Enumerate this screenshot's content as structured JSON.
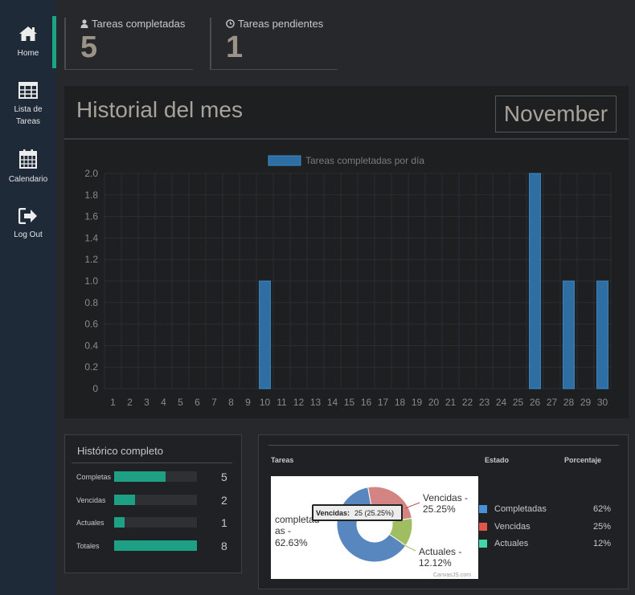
{
  "nav": {
    "items": [
      {
        "label": "Home",
        "icon": "home-icon"
      },
      {
        "label": "Lista de Tareas",
        "icon": "table-icon"
      },
      {
        "label": "Calendario",
        "icon": "calendar-icon"
      },
      {
        "label": "Log Out",
        "icon": "logout-icon"
      }
    ]
  },
  "stats": {
    "completed_label": "Tareas completadas",
    "completed_value": "5",
    "pending_label": "Tareas pendientes",
    "pending_value": "1"
  },
  "history": {
    "title": "Historial del mes",
    "month": "November"
  },
  "chart_data": {
    "type": "bar",
    "legend": "Tareas completadas por día",
    "categories": [
      "1",
      "2",
      "3",
      "4",
      "5",
      "6",
      "7",
      "8",
      "9",
      "10",
      "11",
      "12",
      "13",
      "14",
      "15",
      "16",
      "17",
      "18",
      "19",
      "20",
      "21",
      "22",
      "23",
      "24",
      "25",
      "26",
      "27",
      "28",
      "29",
      "30"
    ],
    "series": [
      {
        "name": "Tareas completadas por día",
        "values": [
          0,
          0,
          0,
          0,
          0,
          0,
          0,
          0,
          0,
          1,
          0,
          0,
          0,
          0,
          0,
          0,
          0,
          0,
          0,
          0,
          0,
          0,
          0,
          0,
          0,
          2,
          0,
          1,
          0,
          1
        ]
      }
    ],
    "ylim": [
      0,
      2
    ],
    "yticks": [
      "0",
      "0.2",
      "0.4",
      "0.6",
      "0.8",
      "1.0",
      "1.2",
      "1.4",
      "1.6",
      "1.8",
      "2.0"
    ],
    "grid": true,
    "legend_position": "top",
    "bar_color": "#2e6ea2"
  },
  "historico": {
    "title": "Histórico completo",
    "rows": [
      {
        "label": "Completas",
        "value": "5",
        "fraction": 0.625
      },
      {
        "label": "Vencidas",
        "value": "2",
        "fraction": 0.25
      },
      {
        "label": "Actuales",
        "value": "1",
        "fraction": 0.125
      },
      {
        "label": "Totales",
        "value": "8",
        "fraction": 1.0
      }
    ]
  },
  "tareas": {
    "col_tareas": "Tareas",
    "col_estado": "Estado",
    "col_porcentaje": "Porcentaje",
    "pie": {
      "tooltip_label": "Vencidas:",
      "tooltip_value": "25 (25.25%)",
      "label_completadas_1": "completad",
      "label_completadas_2": "as -",
      "label_completadas_3": "62.63%",
      "label_vencidas_1": "Vencidas -",
      "label_vencidas_2": "25.25%",
      "label_actuales_1": "Actuales -",
      "label_actuales_2": "12.12%",
      "credit": "CanvasJS.com",
      "slices": [
        {
          "name": "Completadas",
          "percent": 62.63,
          "color": "#4f81bc"
        },
        {
          "name": "Vencidas",
          "percent": 25.25,
          "color": "#c0504e"
        },
        {
          "name": "Actuales",
          "percent": 12.12,
          "color": "#9bbb58"
        }
      ]
    },
    "legend": [
      {
        "name": "Completadas",
        "percent": "62%",
        "color": "#4a90d9"
      },
      {
        "name": "Vencidas",
        "percent": "25%",
        "color": "#e0574a"
      },
      {
        "name": "Actuales",
        "percent": "12%",
        "color": "#40d6a8"
      }
    ]
  }
}
